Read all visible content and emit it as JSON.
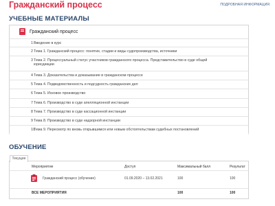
{
  "header": {
    "title": "Гражданский процесс",
    "more_link": "ПОДРОБНАЯ ИНФОРМАЦИЯ"
  },
  "materials": {
    "heading": "УЧЕБНЫЕ МАТЕРИАЛЫ",
    "course_label": "Гражданский процесс",
    "items": [
      {
        "num": "1",
        "text": "Введение в курс"
      },
      {
        "num": "2",
        "text": "Тема 1. Гражданский процесс: понятие, стадии и виды судопроизводства, источники"
      },
      {
        "num": "3",
        "text": "Тема 2. Процессуальный статус участников гражданского процесса. Представительство в суде общей юрисдикции"
      },
      {
        "num": "4",
        "text": "Тема 3. Доказательства и доказывание в гражданском процессе"
      },
      {
        "num": "5",
        "text": "Тема 4. Подведомственность и подсудность гражданских дел"
      },
      {
        "num": "6",
        "text": "Тема 5. Исковое производство"
      },
      {
        "num": "7",
        "text": "Тема 6. Производство в суде апелляционной инстанции"
      },
      {
        "num": "8",
        "text": "Тема 7. Производство в суде кассационной инстанции"
      },
      {
        "num": "9",
        "text": "Тема 8. Производство в суде надзорной инстанции"
      },
      {
        "num": "10",
        "text": "Тема 9. Пересмотр по вновь открывшимся или новым обстоятельствам судебных постановлений"
      }
    ]
  },
  "learning": {
    "heading": "ОБУЧЕНИЕ",
    "tab_current": "Текущие",
    "columns": {
      "event": "Мероприятие",
      "access": "Доступ",
      "max": "Максимальный балл",
      "result": "Результат"
    },
    "row": {
      "name": "Гражданский процесс (обучение)",
      "dates": "01.09.2020 – 13.02.2021",
      "max": "100",
      "result": "100"
    },
    "total": {
      "label": "ВСЕ МЕРОПРИЯТИЯ",
      "max": "100",
      "result": "100"
    }
  },
  "colors": {
    "title": "#d9324a",
    "heading": "#27456b",
    "icon": "#d9324a"
  }
}
